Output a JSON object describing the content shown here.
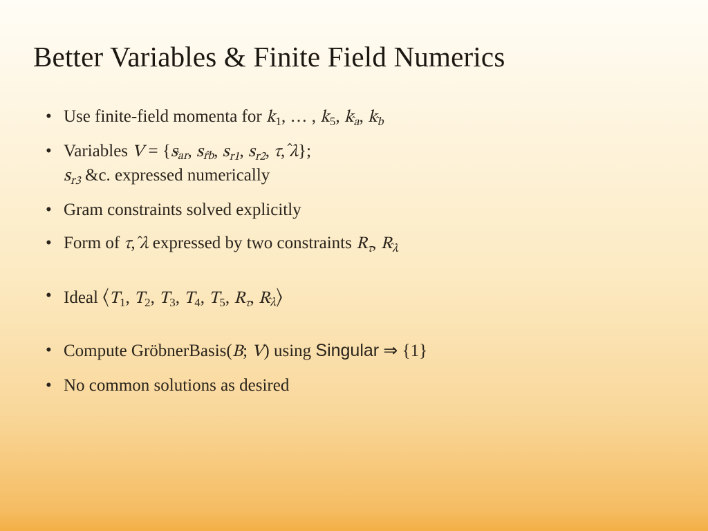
{
  "title": "Better Variables & Finite Field Numerics",
  "bullets": {
    "b1_pre": "Use finite-field momenta for ",
    "b2_pre": "Variables ",
    "b2_post": " &c. expressed numerically",
    "b3": "Gram constraints solved explicitly",
    "b4_pre": "Form of ",
    "b4_mid": " expressed by two constraints ",
    "b5_pre": "Ideal ",
    "b6_pre": "Compute GröbnerBasis(",
    "b6_mid": ") using ",
    "b6_sans": "Singular",
    "b6_post": " ⇒ {1}",
    "b7": "No common solutions as desired"
  },
  "math": {
    "k": "k",
    "s": "s",
    "V": "V",
    "T": "T",
    "R": "R",
    "B": "B",
    "tau": "τ",
    "lambda": "λ",
    "d1": "1",
    "d2": "2",
    "d3": "3",
    "d4": "4",
    "d5": "5",
    "a": "a",
    "b": "b",
    "r": "r",
    "eq": " = ",
    "lbrace": "{",
    "rbrace": "}",
    "semicolon": ";",
    "comma": ", ",
    "dots": "… ",
    "lang": "⟨",
    "rang": "⟩",
    "ar": "ar",
    "rb": "rb",
    "r1": "r1",
    "r2": "r2",
    "r3": "r3"
  }
}
